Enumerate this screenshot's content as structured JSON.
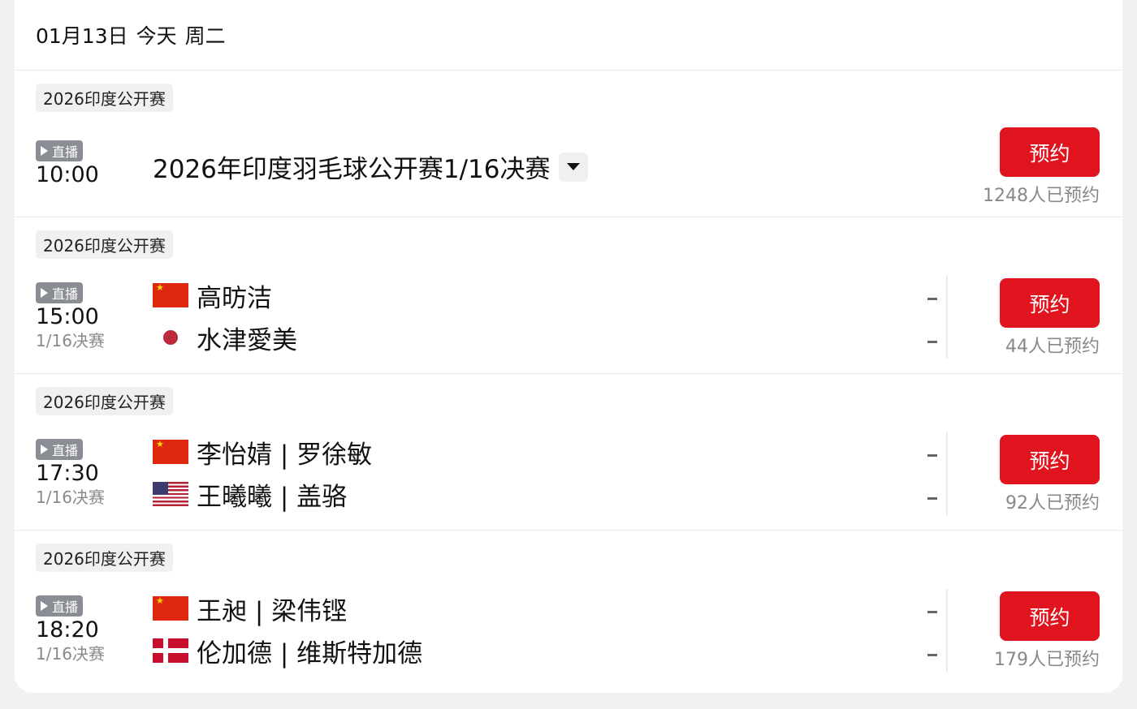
{
  "header": {
    "date": "01月13日",
    "today": "今天",
    "weekday": "周二"
  },
  "live_label": "直播",
  "reserve_label": "预约",
  "events": [
    {
      "tournament": "2026印度公开赛",
      "time": "10:00",
      "title": "2026年印度羽毛球公开赛1/16决赛",
      "reserve_count": "1248人已预约"
    },
    {
      "tournament": "2026印度公开赛",
      "time": "15:00",
      "round": "1/16决赛",
      "players": [
        {
          "name": "高昉洁",
          "flag": "china-flag-icon",
          "score": "-"
        },
        {
          "name": "水津愛美",
          "flag": "japan-flag-icon",
          "score": "-"
        }
      ],
      "reserve_count": "44人已预约"
    },
    {
      "tournament": "2026印度公开赛",
      "time": "17:30",
      "round": "1/16决赛",
      "players": [
        {
          "name": "李怡婧 | 罗徐敏",
          "flag": "china-flag-icon",
          "score": "-"
        },
        {
          "name": "王曦曦 | 盖骆",
          "flag": "usa-flag-icon",
          "score": "-"
        }
      ],
      "reserve_count": "92人已预约"
    },
    {
      "tournament": "2026印度公开赛",
      "time": "18:20",
      "round": "1/16决赛",
      "players": [
        {
          "name": "王昶 | 梁伟铿",
          "flag": "china-flag-icon",
          "score": "-"
        },
        {
          "name": "伦加德 | 维斯特加德",
          "flag": "denmark-flag-icon",
          "score": "-"
        }
      ],
      "reserve_count": "179人已预约"
    }
  ],
  "colors": {
    "accent": "#e0141e",
    "badge": "#8a8d94",
    "muted": "#888888"
  }
}
